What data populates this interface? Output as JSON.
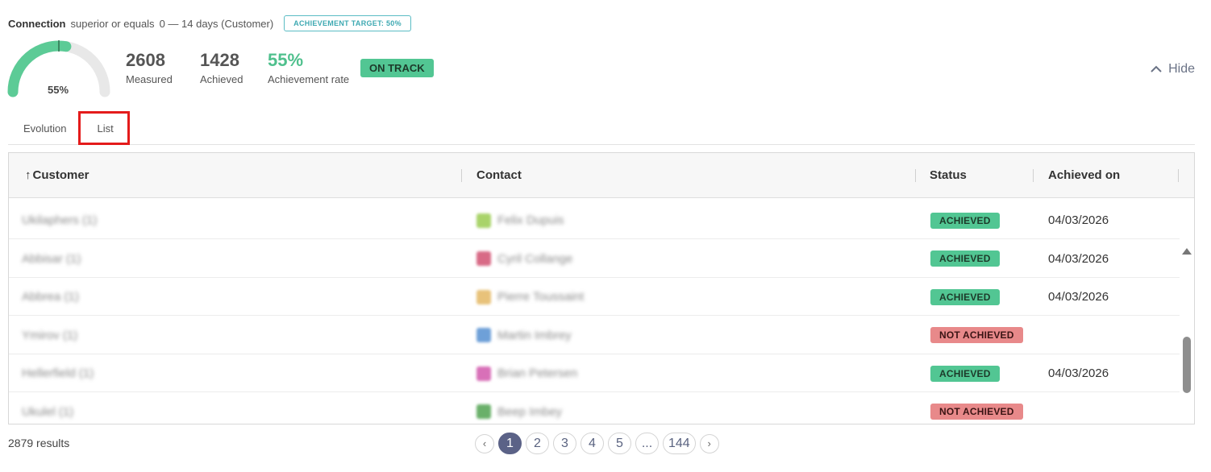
{
  "header": {
    "metric_name": "Connection",
    "operator": "superior or equals",
    "range": "0  — 14 days (Customer)",
    "target_badge": "ACHIEVEMENT TARGET: 50%"
  },
  "gauge": {
    "percent_label": "55%",
    "value": 0.55,
    "target": 0.5,
    "fill_color": "#5ccb96",
    "track_color": "#e8e8e8"
  },
  "kpis": {
    "measured": {
      "value": "2608",
      "label": "Measured"
    },
    "achieved": {
      "value": "1428",
      "label": "Achieved"
    },
    "rate": {
      "value": "55%",
      "label": "Achievement rate"
    }
  },
  "status_badge": "ON TRACK",
  "hide_label": "Hide",
  "tabs": [
    {
      "label": "Evolution"
    },
    {
      "label": "List"
    }
  ],
  "table": {
    "columns": [
      "Customer",
      "Contact",
      "Status",
      "Achieved on"
    ],
    "rows": [
      {
        "customer": "Ukilaphers (1)",
        "contact": "Felix Dupuis",
        "avatar_color": "#a9d36a",
        "status": "ACHIEVED",
        "status_type": "achieved",
        "achieved_on": "04/03/2026"
      },
      {
        "customer": "Abbisar (1)",
        "contact": "Cyril Collange",
        "avatar_color": "#d86a86",
        "status": "ACHIEVED",
        "status_type": "achieved",
        "achieved_on": "04/03/2026"
      },
      {
        "customer": "Abbrea (1)",
        "contact": "Pierre Toussaint",
        "avatar_color": "#e8c27a",
        "status": "ACHIEVED",
        "status_type": "achieved",
        "achieved_on": "04/03/2026"
      },
      {
        "customer": "Ymirov (1)",
        "contact": "Martin Imbrey",
        "avatar_color": "#6ea0d8",
        "status": "NOT ACHIEVED",
        "status_type": "not-achieved",
        "achieved_on": ""
      },
      {
        "customer": "Hellerfield (1)",
        "contact": "Brian Petersen",
        "avatar_color": "#d870b8",
        "status": "ACHIEVED",
        "status_type": "achieved",
        "achieved_on": "04/03/2026"
      },
      {
        "customer": "Ukulel (1)",
        "contact": "Beep Imbey",
        "avatar_color": "#6ab06a",
        "status": "NOT ACHIEVED",
        "status_type": "not-achieved",
        "achieved_on": ""
      }
    ]
  },
  "footer": {
    "results": "2879 results",
    "pages": [
      "1",
      "2",
      "3",
      "4",
      "5",
      "...",
      "144"
    ],
    "prev": "‹",
    "next": "›"
  }
}
